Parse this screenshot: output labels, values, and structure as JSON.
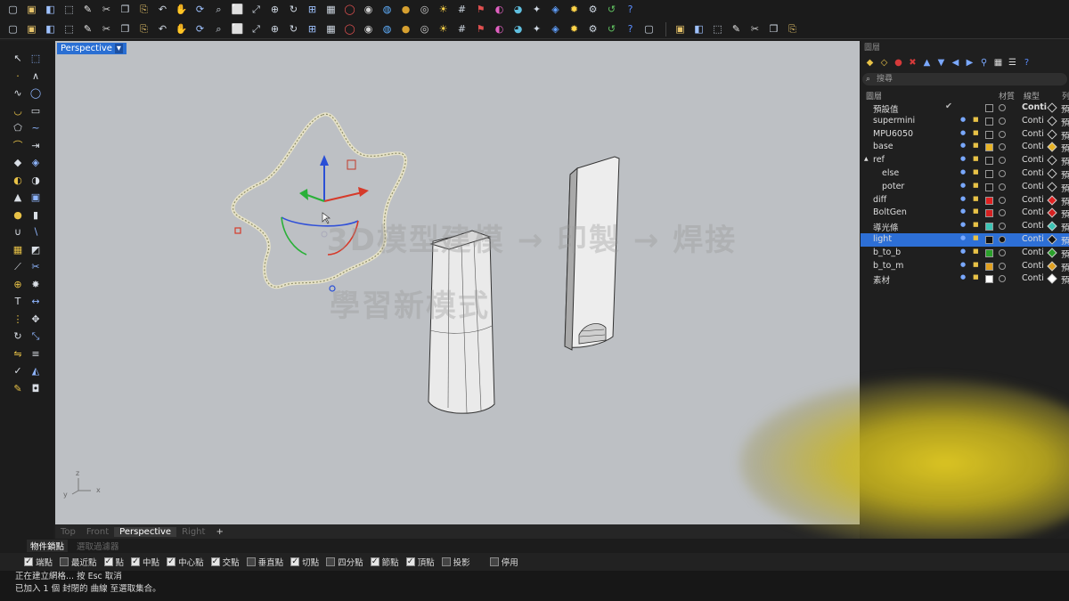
{
  "toolbar": {
    "row1_icons": [
      "new-file-icon",
      "open-folder-icon",
      "save-icon",
      "print-icon",
      "document-icon",
      "cut-icon",
      "copy-icon",
      "paste-icon",
      "undo-icon",
      "pan-hand-icon",
      "rotate-view-icon",
      "zoom-icon",
      "zoom-window-icon",
      "zoom-extents-icon",
      "zoom-selected-icon",
      "rotate-icon",
      "four-viewports-icon",
      "layout-icon",
      "wireframe-icon",
      "shaded-icon",
      "ghosted-icon",
      "rendered-icon",
      "target-icon",
      "lightbulb-icon",
      "grid-icon",
      "flag-icon",
      "color-wheel-icon",
      "material-icon",
      "render-icon",
      "environment-icon",
      "sun-icon",
      "options-icon",
      "update-icon",
      "help-icon"
    ],
    "row2_icons": [
      "curve-tools-icon",
      "point-icon",
      "line-icon",
      "polyline-icon",
      "arc-icon",
      "circle-icon",
      "ellipse-icon",
      "polygon-icon",
      "offset-icon",
      "fillet-icon",
      "chamfer-icon",
      "extend-icon",
      "trim-icon",
      "split-icon",
      "join-icon",
      "explode-icon",
      "gem-icon",
      "text-icon",
      "text-object-icon",
      "dimension-icon",
      "leader-icon",
      "hatch-icon",
      "block-icon",
      "group-icon",
      "mesh-icon",
      "transform-icon",
      "array-icon",
      "solid-icon",
      "boolean-icon",
      "layer-icon",
      "folder-icon",
      "properties-icon",
      "analyze-icon",
      "render-settings-icon",
      "mirror-icon",
      "history-icon",
      "snap-tools-icon",
      "align-left-icon",
      "align-center-icon",
      "align-right-icon",
      "distribute-icon",
      "bound-icon"
    ]
  },
  "left_tools": [
    "select-icon",
    "select-window-icon",
    "point-icon",
    "polyline-icon",
    "curve-icon",
    "circle-icon",
    "arc-icon",
    "rectangle-icon",
    "polygon-icon",
    "curve-freeform-icon",
    "fillet-icon",
    "extend-icon",
    "surface-icon",
    "loft-icon",
    "revolve-icon",
    "sweep-icon",
    "extrude-icon",
    "box-icon",
    "sphere-icon",
    "cylinder-icon",
    "boolean-union-icon",
    "boolean-diff-icon",
    "mesh-icon",
    "patch-icon",
    "split-icon",
    "trim-icon",
    "join-icon",
    "explode-icon",
    "text-icon",
    "dimension-icon",
    "array-icon",
    "move-icon",
    "rotate-icon",
    "scale-icon",
    "mirror-icon",
    "align-icon",
    "check-icon",
    "analysis-icon",
    "paint-icon",
    "bucket-icon"
  ],
  "viewport": {
    "label": "Perspective",
    "watermark_line1": "3D模型建模 → 印製 → 焊接",
    "watermark_line2": "學習新模式",
    "axis_x": "x",
    "axis_y": "y",
    "axis_z": "z"
  },
  "viewport_tabs": [
    "Top",
    "Front",
    "Perspective",
    "Right"
  ],
  "viewport_tab_active": "Perspective",
  "viewport_tab_add": "+",
  "right_panel": {
    "title": "圖層",
    "icons": [
      "layer-new-icon",
      "sublayer-icon",
      "delete-icon",
      "filter-icon",
      "move-up-icon",
      "move-down-icon",
      "move-left-icon",
      "move-right-icon",
      "funnel-icon",
      "grid-icon",
      "list-icon",
      "help-icon"
    ],
    "search_placeholder": "搜尋",
    "headers": {
      "name": "圖層",
      "material": "材質",
      "linetype": "線型",
      "print": "列"
    },
    "layers": [
      {
        "name": "預設值",
        "indent": 0,
        "color": "#1a1a1a",
        "linetype": "Conti",
        "current": true,
        "mat_filled": false,
        "diamond": "#1a1a1a"
      },
      {
        "name": "supermini",
        "indent": 0,
        "color": "#1a1a1a",
        "linetype": "Conti",
        "current": false,
        "mat_filled": false,
        "diamond": "#1a1a1a"
      },
      {
        "name": "MPU6050",
        "indent": 0,
        "color": "#1a1a1a",
        "linetype": "Conti",
        "current": false,
        "mat_filled": false,
        "diamond": "#1a1a1a"
      },
      {
        "name": "base",
        "indent": 0,
        "color": "#e8b325",
        "linetype": "Conti",
        "current": false,
        "mat_filled": false,
        "diamond": "#e8b325"
      },
      {
        "name": "ref",
        "indent": 0,
        "color": "#1a1a1a",
        "linetype": "Conti",
        "current": false,
        "mat_filled": false,
        "diamond": "#1a1a1a",
        "expander": "▲"
      },
      {
        "name": "else",
        "indent": 1,
        "color": "#1a1a1a",
        "linetype": "Conti",
        "current": false,
        "mat_filled": false,
        "diamond": "#1a1a1a"
      },
      {
        "name": "poter",
        "indent": 1,
        "color": "#1a1a1a",
        "linetype": "Conti",
        "current": false,
        "mat_filled": false,
        "diamond": "#1a1a1a"
      },
      {
        "name": "diff",
        "indent": 0,
        "color": "#e02020",
        "linetype": "Conti",
        "current": false,
        "mat_filled": false,
        "diamond": "#e02020"
      },
      {
        "name": "BoltGen",
        "indent": 0,
        "color": "#d52020",
        "linetype": "Conti",
        "current": false,
        "mat_filled": false,
        "diamond": "#d52020"
      },
      {
        "name": "導光條",
        "indent": 0,
        "color": "#3cc4b4",
        "linetype": "Conti",
        "current": false,
        "mat_filled": false,
        "diamond": "#3cc4b4"
      },
      {
        "name": "light",
        "indent": 0,
        "color": "#111111",
        "linetype": "Conti",
        "current": false,
        "mat_filled": true,
        "diamond": "#111111",
        "selected": true
      },
      {
        "name": "b_to_b",
        "indent": 0,
        "color": "#2aa02a",
        "linetype": "Conti",
        "current": false,
        "mat_filled": false,
        "diamond": "#2aa02a"
      },
      {
        "name": "b_to_m",
        "indent": 0,
        "color": "#e0a020",
        "linetype": "Conti",
        "current": false,
        "mat_filled": false,
        "diamond": "#e0a020"
      },
      {
        "name": "素材",
        "indent": 0,
        "color": "#ffffff",
        "linetype": "Conti",
        "current": false,
        "mat_filled": false,
        "diamond": "#ffffff"
      }
    ],
    "print_glyph": "預",
    "current_mark": "✔"
  },
  "bottom_tabs": [
    {
      "label": "物件鎖點",
      "active": true
    },
    {
      "label": "選取過濾器",
      "active": false
    }
  ],
  "osnaps": [
    {
      "label": "端點",
      "checked": true
    },
    {
      "label": "最近點",
      "checked": false
    },
    {
      "label": "點",
      "checked": true
    },
    {
      "label": "中點",
      "checked": true
    },
    {
      "label": "中心點",
      "checked": true
    },
    {
      "label": "交點",
      "checked": true
    },
    {
      "label": "垂直點",
      "checked": false
    },
    {
      "label": "切點",
      "checked": true
    },
    {
      "label": "四分點",
      "checked": false
    },
    {
      "label": "節點",
      "checked": true
    },
    {
      "label": "頂點",
      "checked": true
    },
    {
      "label": "投影",
      "checked": false
    },
    {
      "label": "停用",
      "checked": false
    }
  ],
  "command": {
    "line1": "正在建立網格... 按 Esc 取消",
    "line2": "已加入 1 個 封閉的 曲線 至選取集合。"
  }
}
